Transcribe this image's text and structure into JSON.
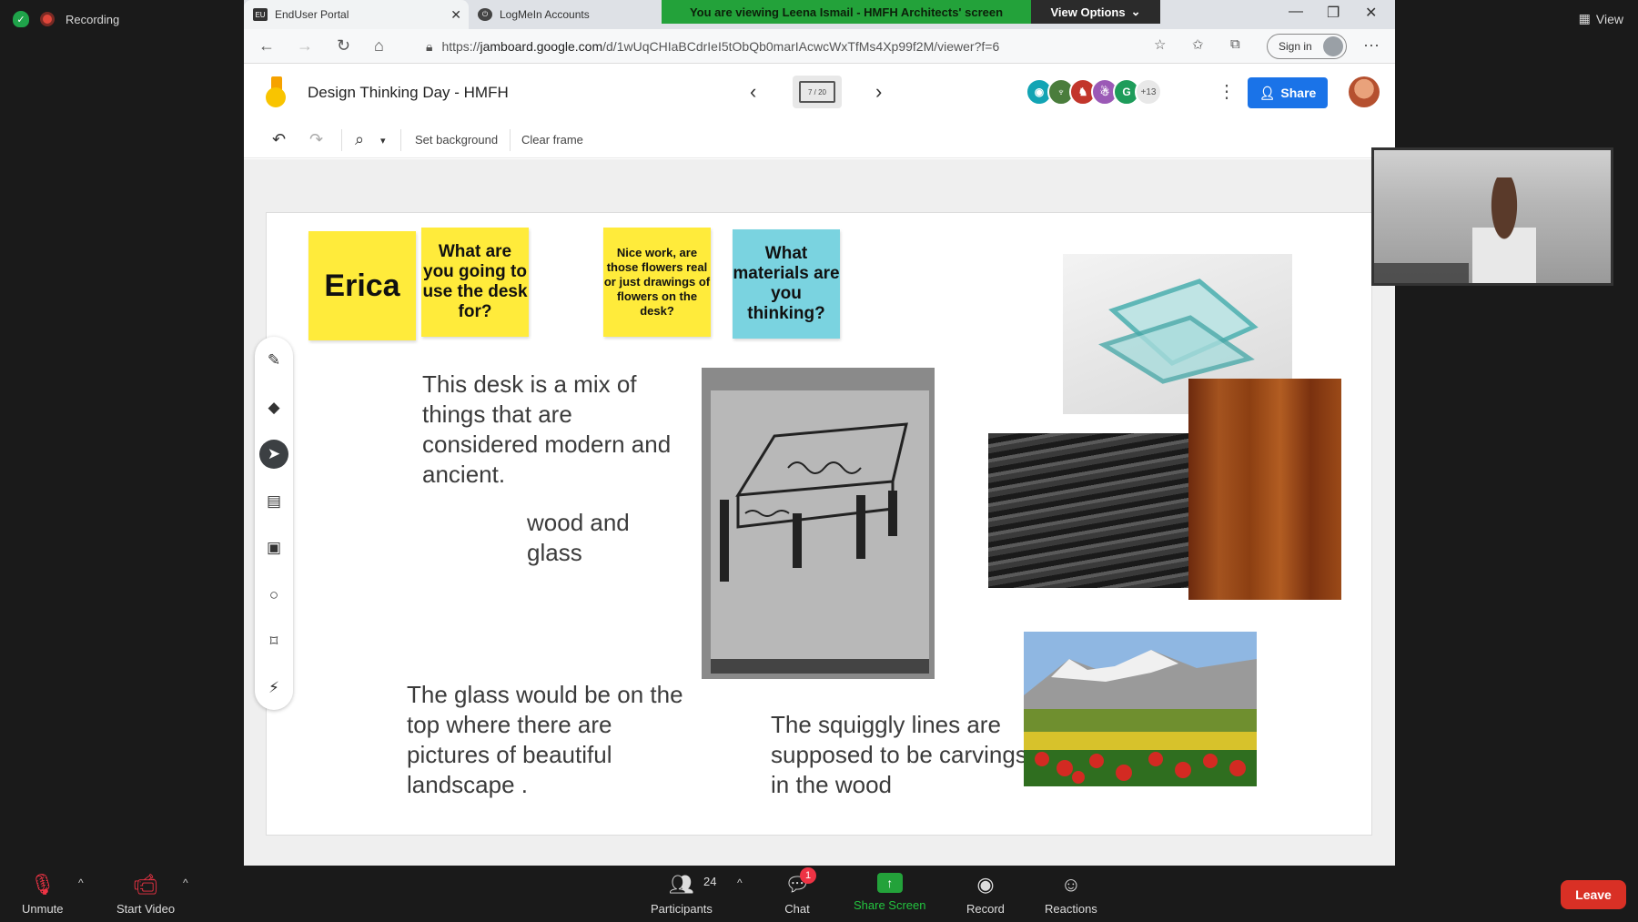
{
  "zoom": {
    "recording_label": "Recording",
    "view_label": "View",
    "viewing_banner": "You are viewing Leena Ismail - HMFH Architects' screen",
    "view_options_label": "View Options",
    "bottom_bar": {
      "unmute": "Unmute",
      "start_video": "Start Video",
      "participants": "Participants",
      "participants_count": "24",
      "chat": "Chat",
      "chat_badge": "1",
      "share_screen": "Share Screen",
      "record": "Record",
      "reactions": "Reactions",
      "leave": "Leave"
    }
  },
  "browser": {
    "tabs": [
      {
        "label": "EndUser Portal",
        "icon": "enduser-favicon"
      },
      {
        "label": "LogMeIn Accounts",
        "icon": "logmein-favicon"
      }
    ],
    "url_prefix": "https://",
    "url_host": "jamboard.google.com",
    "url_path": "/d/1wUqCHIaBCdrIeI5tObQb0marIAcwcWxTfMs4Xp99f2M/viewer?f=6",
    "sign_in_label": "Sign in"
  },
  "jamboard": {
    "title": "Design Thinking Day - HMFH",
    "frame_indicator": "7 / 20",
    "collaborators_more": "+13",
    "share_label": "Share",
    "toolbar": {
      "set_background": "Set background",
      "clear_frame": "Clear frame"
    },
    "stickies": {
      "name": "Erica",
      "q1": "What are you going to use the desk for?",
      "q2": "Nice work, are those flowers real or just drawings of flowers on the desk?",
      "q3": "What materials are you thinking?"
    },
    "texts": {
      "desk": "This desk is a mix of things that are considered modern and ancient.",
      "wood": "wood and glass",
      "glass": "The glass would be on the top where there are pictures of beautiful landscape .",
      "squiggly": "The squiggly lines are supposed to be carvings in the wood"
    }
  },
  "colors": {
    "green_banner": "#23a23a",
    "share_blue": "#1a73e8",
    "sticky_yellow": "#ffeb3b",
    "sticky_cyan": "#7ad3e0",
    "leave_red": "#d93025"
  }
}
